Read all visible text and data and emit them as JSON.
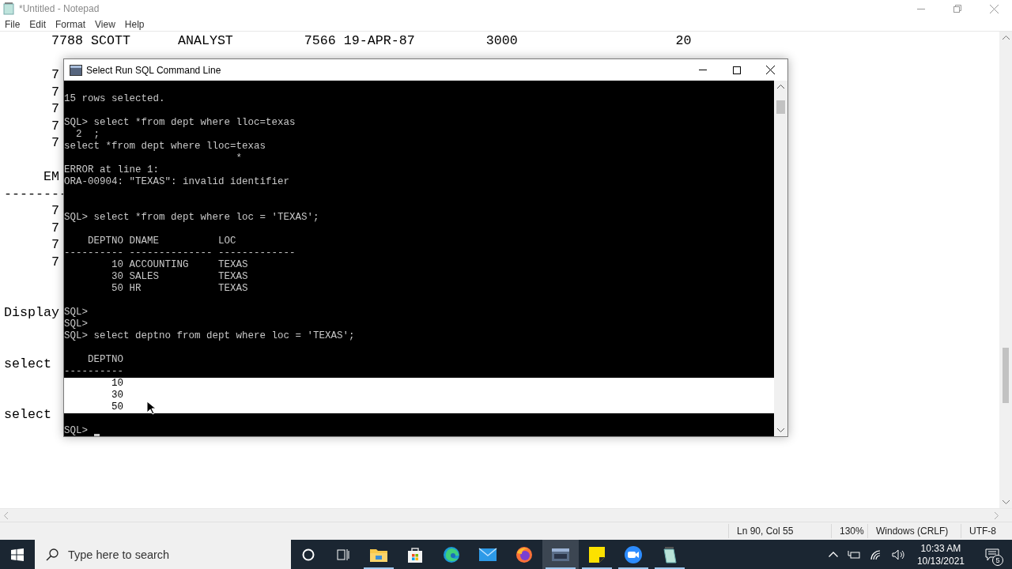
{
  "notepad": {
    "title": "*Untitled - Notepad",
    "menu": [
      "File",
      "Edit",
      "Format",
      "View",
      "Help"
    ],
    "lines": [
      {
        "kind": "text",
        "text": "      7788 SCOTT      ANALYST         7566 19-APR-87         3000                    20"
      },
      {
        "kind": "blank"
      },
      {
        "kind": "text",
        "text": "      7"
      },
      {
        "kind": "text",
        "text": "      7"
      },
      {
        "kind": "text",
        "text": "      7"
      },
      {
        "kind": "text",
        "text": "      7"
      },
      {
        "kind": "text",
        "text": "      7"
      },
      {
        "kind": "blank"
      },
      {
        "kind": "text",
        "text": "     EM"
      },
      {
        "kind": "text",
        "text": "--------"
      },
      {
        "kind": "text",
        "text": "      7"
      },
      {
        "kind": "text",
        "text": "      7"
      },
      {
        "kind": "text",
        "text": "      7"
      },
      {
        "kind": "text",
        "text": "      7"
      },
      {
        "kind": "blank"
      },
      {
        "kind": "blank"
      },
      {
        "kind": "text",
        "text": "Display"
      },
      {
        "kind": "blank"
      },
      {
        "kind": "blank"
      },
      {
        "kind": "text",
        "text": "select"
      },
      {
        "kind": "blank"
      },
      {
        "kind": "blank"
      },
      {
        "kind": "text",
        "text": "select"
      }
    ],
    "status_bar": [
      "Ln 90, Col 55",
      "130%",
      "Windows (CRLF)",
      "UTF-8"
    ]
  },
  "console": {
    "title": "Select Run SQL Command Line",
    "lines": [
      {
        "kind": "blank",
        "selected": false
      },
      {
        "kind": "text",
        "text": "15 rows selected.",
        "selected": false
      },
      {
        "kind": "blank",
        "selected": false
      },
      {
        "kind": "text",
        "text": "SQL> select *from dept where lloc=texas",
        "selected": false
      },
      {
        "kind": "text",
        "text": "  2  ;",
        "selected": false
      },
      {
        "kind": "text",
        "text": "select *from dept where lloc=texas",
        "selected": false
      },
      {
        "kind": "text",
        "text": "                             *",
        "selected": false
      },
      {
        "kind": "text",
        "text": "ERROR at line 1:",
        "selected": false
      },
      {
        "kind": "text",
        "text": "ORA-00904: \"TEXAS\": invalid identifier",
        "selected": false
      },
      {
        "kind": "blank",
        "selected": false
      },
      {
        "kind": "blank",
        "selected": false
      },
      {
        "kind": "text",
        "text": "SQL> select *from dept where loc = 'TEXAS';",
        "selected": false
      },
      {
        "kind": "blank",
        "selected": false
      },
      {
        "kind": "text",
        "text": "    DEPTNO DNAME          LOC",
        "selected": false
      },
      {
        "kind": "text",
        "text": "---------- -------------- -------------",
        "selected": false
      },
      {
        "kind": "text",
        "text": "        10 ACCOUNTING     TEXAS",
        "selected": false
      },
      {
        "kind": "text",
        "text": "        30 SALES          TEXAS",
        "selected": false
      },
      {
        "kind": "text",
        "text": "        50 HR             TEXAS",
        "selected": false
      },
      {
        "kind": "blank",
        "selected": false
      },
      {
        "kind": "text",
        "text": "SQL>",
        "selected": false
      },
      {
        "kind": "text",
        "text": "SQL>",
        "selected": false
      },
      {
        "kind": "text",
        "text": "SQL> select deptno from dept where loc = 'TEXAS';",
        "selected": false
      },
      {
        "kind": "blank",
        "selected": false
      },
      {
        "kind": "text",
        "text": "    DEPTNO",
        "selected": false
      },
      {
        "kind": "text",
        "text": "----------",
        "selected": false
      },
      {
        "kind": "text",
        "text": "        10",
        "selected": true
      },
      {
        "kind": "text",
        "text": "        30",
        "selected": true
      },
      {
        "kind": "text",
        "text": "        50",
        "selected": true
      },
      {
        "kind": "blank",
        "selected": false
      },
      {
        "kind": "prompt",
        "text": "SQL>",
        "selected": false
      }
    ]
  },
  "taskbar": {
    "search_placeholder": "Type here to search",
    "apps": [
      {
        "kind": "explorer",
        "running": true,
        "active": false
      },
      {
        "kind": "store",
        "running": false,
        "active": false
      },
      {
        "kind": "edge",
        "running": false,
        "active": false
      },
      {
        "kind": "mail",
        "running": false,
        "active": false
      },
      {
        "kind": "firefox",
        "running": false,
        "active": false
      },
      {
        "kind": "console",
        "running": true,
        "active": true
      },
      {
        "kind": "sticky",
        "running": true,
        "active": false
      },
      {
        "kind": "zoom",
        "running": true,
        "active": false
      },
      {
        "kind": "notepad",
        "running": true,
        "active": false
      }
    ],
    "time": "10:33 AM",
    "date": "10/13/2021",
    "notifications": "5"
  }
}
